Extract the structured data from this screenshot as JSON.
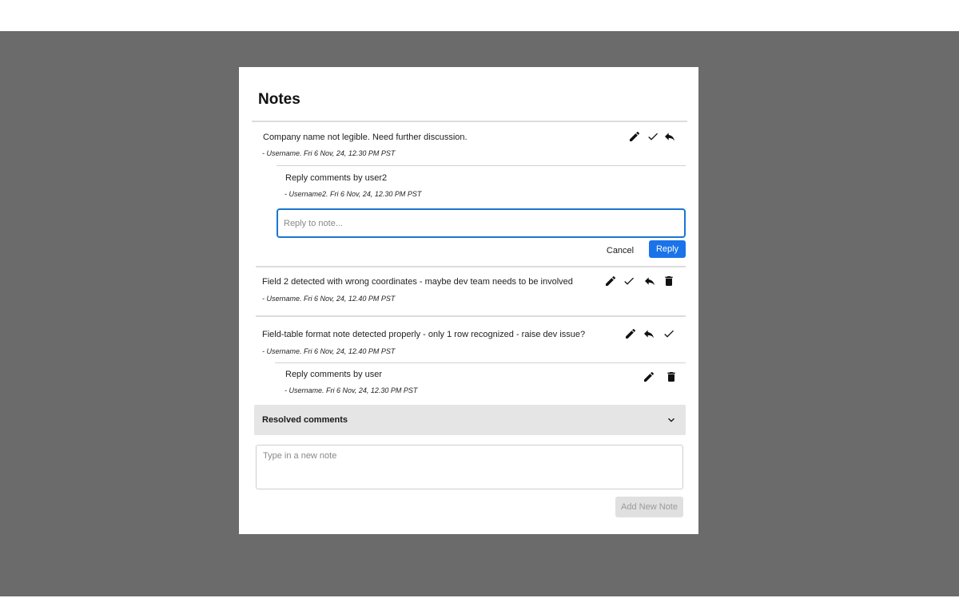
{
  "dialog": {
    "title": "Notes"
  },
  "notes": [
    {
      "text": "Company name not legible. Need further discussion.",
      "meta": "- Username. Fri 6 Nov, 24, 12.30 PM PST",
      "actions": [
        "pencil-icon",
        "check-icon",
        "reply-icon"
      ],
      "replies": [
        {
          "text": "Reply comments by user2",
          "meta": "- Username2. Fri 6 Nov, 24, 12.30 PM PST"
        }
      ]
    },
    {
      "text": "Field 2 detected with wrong coordinates - maybe dev team needs to be involved",
      "meta": "- Username. Fri 6 Nov, 24, 12.40 PM PST",
      "actions": [
        "pencil-icon",
        "check-icon",
        "reply-icon",
        "trash-icon"
      ]
    },
    {
      "text": "Field-table format note detected properly - only 1 row recognized - raise dev issue?",
      "meta": "- Username. Fri 6 Nov, 24, 12.40 PM PST",
      "actions": [
        "pencil-icon",
        "reply-icon",
        "check-icon"
      ],
      "replies": [
        {
          "text": "Reply comments by user",
          "meta": "- Username. Fri 6 Nov, 24, 12.30 PM PST",
          "actions": [
            "pencil-icon",
            "trash-icon"
          ]
        }
      ]
    }
  ],
  "reply_box": {
    "placeholder": "Reply to note...",
    "cancel_label": "Cancel",
    "reply_label": "Reply"
  },
  "resolved": {
    "label": "Resolved comments",
    "icon": "chevron-down-icon"
  },
  "new_note": {
    "placeholder": "Type in a new note",
    "button_label": "Add New Note"
  },
  "colors": {
    "backdrop": "#6b6b6b",
    "accent": "#1a73e8",
    "input_focus": "#1976d2",
    "resolved_bg": "#e5e5e5"
  }
}
